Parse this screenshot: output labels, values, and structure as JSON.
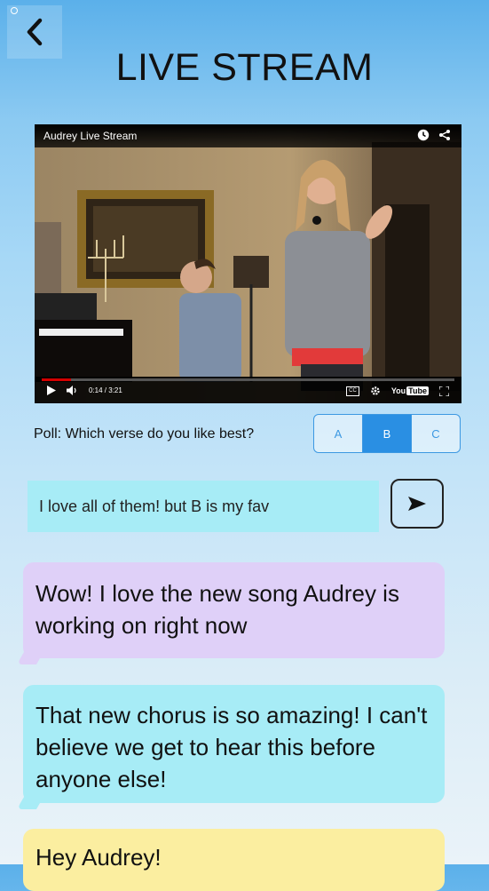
{
  "header": {
    "title": "LIVE STREAM",
    "back_icon": "chevron-left-icon"
  },
  "video": {
    "title": "Audrey Live Stream",
    "time": "0:14 / 3:21",
    "progress": 0.07,
    "brand_you": "You",
    "brand_tube": "Tube",
    "cc_label": "CC",
    "icons": [
      "clock-icon",
      "share-icon",
      "play-icon",
      "volume-icon",
      "captions-icon",
      "settings-icon",
      "youtube-logo",
      "fullscreen-icon"
    ]
  },
  "poll": {
    "question": "Poll: Which verse do you like best?",
    "options": [
      "A",
      "B",
      "C"
    ],
    "selected": "B"
  },
  "composer": {
    "value": "I love all of them! but B is my fav",
    "send_icon": "send-icon"
  },
  "messages": [
    {
      "text": "Wow! I love the new song Audrey is working on right now",
      "color": "#dfd0f8"
    },
    {
      "text": "That new chorus is so amazing! I can't believe we get to hear this before anyone else!",
      "color": "#a7ecf6"
    },
    {
      "text": "Hey Audrey!",
      "color": "#fbeea0"
    }
  ],
  "colors": {
    "accent": "#2a8fe3",
    "progress": "#d40000"
  }
}
